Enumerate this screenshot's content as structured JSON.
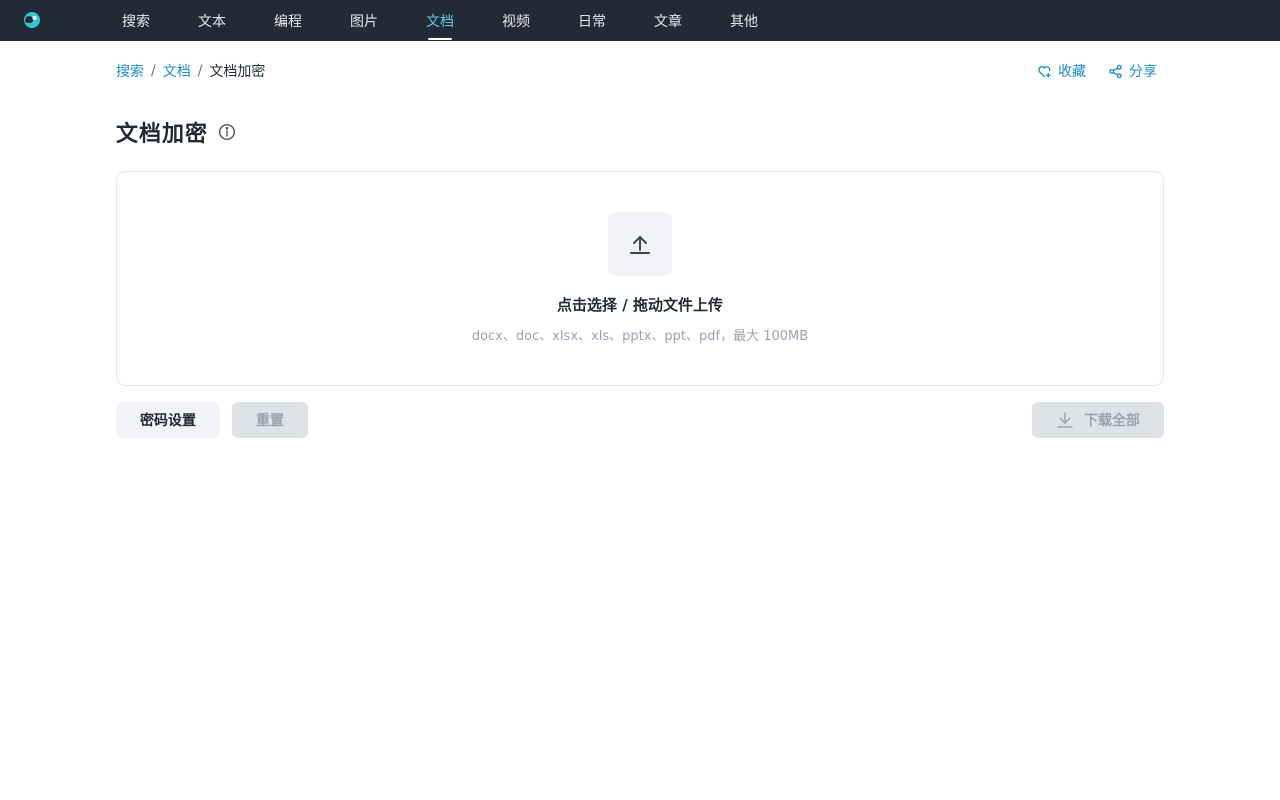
{
  "nav": {
    "items": [
      {
        "label": "搜索",
        "active": false
      },
      {
        "label": "文本",
        "active": false
      },
      {
        "label": "编程",
        "active": false
      },
      {
        "label": "图片",
        "active": false
      },
      {
        "label": "文档",
        "active": true
      },
      {
        "label": "视频",
        "active": false
      },
      {
        "label": "日常",
        "active": false
      },
      {
        "label": "文章",
        "active": false
      },
      {
        "label": "其他",
        "active": false
      }
    ]
  },
  "breadcrumb": {
    "items": [
      "搜索",
      "文档"
    ],
    "separator": "/",
    "current": "文档加密"
  },
  "actions": {
    "favorite_label": "收藏",
    "share_label": "分享"
  },
  "page": {
    "title": "文档加密"
  },
  "upload": {
    "title": "点击选择 / 拖动文件上传",
    "hint": "docx、doc、xlsx、xls、pptx、ppt、pdf，最大 100MB"
  },
  "buttons": {
    "password_settings": "密码设置",
    "reset": "重置",
    "download_all": "下载全部"
  },
  "colors": {
    "topbar_bg": "#232a36",
    "accent": "#1a8fc9",
    "nav_active": "#5ccfe6",
    "disabled_bg": "#dfe2e7"
  }
}
